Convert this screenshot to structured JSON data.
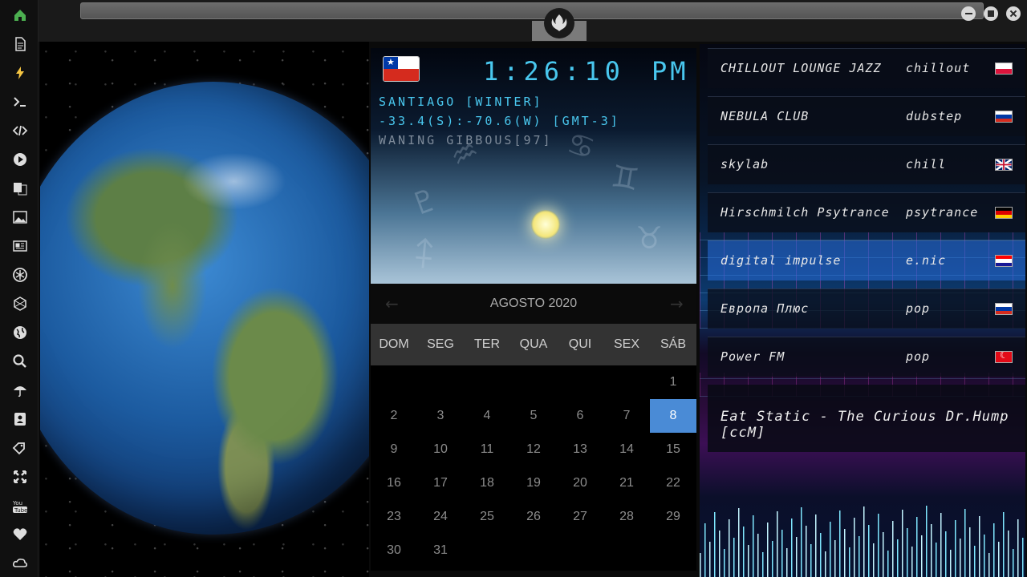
{
  "sidebar": {
    "icons": [
      "home-icon",
      "document-icon",
      "bolt-icon",
      "terminal-icon",
      "code-icon",
      "play-icon",
      "translate-icon",
      "image-icon",
      "news-icon",
      "rebel-icon",
      "hexagon-icon",
      "globe-icon",
      "search-icon",
      "umbrella-icon",
      "contacts-icon",
      "tags-icon",
      "expand-icon",
      "youtube-icon",
      "heart-icon",
      "cloud-icon"
    ],
    "accent": "#4caf50"
  },
  "clock": {
    "time": "1:26:10",
    "ampm": "PM",
    "city": "SANTIAGO [WINTER]",
    "coords": "-33.4(S):-70.6(W) [GMT-3]",
    "moon": "WANING GIBBOUS[97]"
  },
  "calendar": {
    "title": "AGOSTO 2020",
    "weekdays": [
      "DOM",
      "SEG",
      "TER",
      "QUA",
      "QUI",
      "SEX",
      "SÁB"
    ],
    "first_weekday_index": 6,
    "days_in_month": 31,
    "today": 8,
    "today_color": "#4a8bd6"
  },
  "radio": {
    "stations": [
      {
        "name": "CHILLOUT LOUNGE JAZZ",
        "genre": "chillout",
        "country": "pl"
      },
      {
        "name": "NEBULA CLUB",
        "genre": "dubstep",
        "country": "ru"
      },
      {
        "name": "skylab",
        "genre": "chill",
        "country": "gb"
      },
      {
        "name": "Hirschmilch Psytrance",
        "genre": "psytrance",
        "country": "de"
      },
      {
        "name": "digital impulse",
        "genre": "e.nic",
        "country": "hr",
        "active": true
      },
      {
        "name": "Европа Плюс",
        "genre": "pop",
        "country": "ru"
      },
      {
        "name": "Power FM",
        "genre": "pop",
        "country": "tr"
      }
    ],
    "now_playing": "Eat Static - The Curious Dr.Hump [ccM]"
  }
}
